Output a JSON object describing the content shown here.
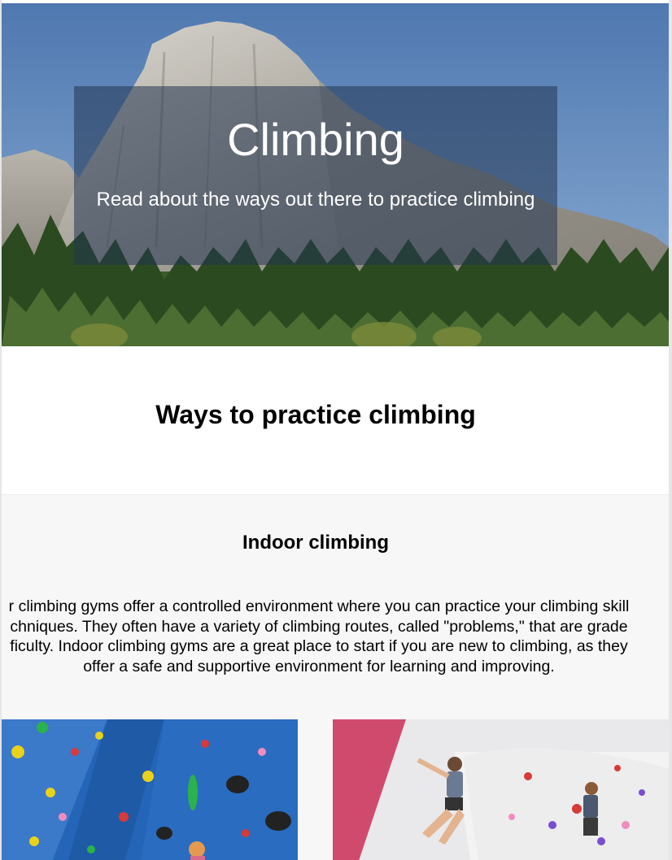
{
  "hero": {
    "title": "Climbing",
    "subtitle": "Read about the ways out there to practice climbing",
    "image_icon": "el-capitan-photo"
  },
  "main": {
    "heading": "Ways to practice climbing"
  },
  "indoor": {
    "heading": "Indoor climbing",
    "body_lines": [
      "r climbing gyms offer a controlled environment where you can practice your climbing skill",
      "chniques. They often have a variety of climbing routes, called \"problems,\" that are grade",
      "ficulty. Indoor climbing gyms are a great place to start if you are new to climbing, as they",
      "offer a safe and supportive environment for learning and improving."
    ],
    "photos": [
      "climbing-wall-photo",
      "bouldering-gym-photo"
    ]
  },
  "colors": {
    "sky": "#5e83b8",
    "rock": "#9c9890",
    "trees": "#2f4a22",
    "overlay": "#233450",
    "section_bg": "#f7f7f7",
    "wall_blue": "#2565b8"
  }
}
